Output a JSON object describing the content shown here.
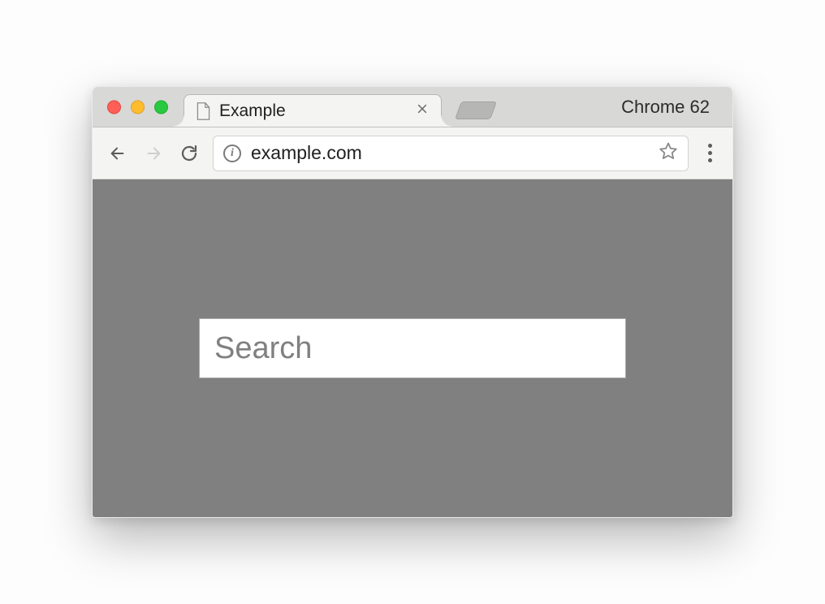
{
  "browser_label": "Chrome 62",
  "tab": {
    "title": "Example"
  },
  "toolbar": {
    "url": "example.com"
  },
  "page": {
    "search_placeholder": "Search"
  }
}
